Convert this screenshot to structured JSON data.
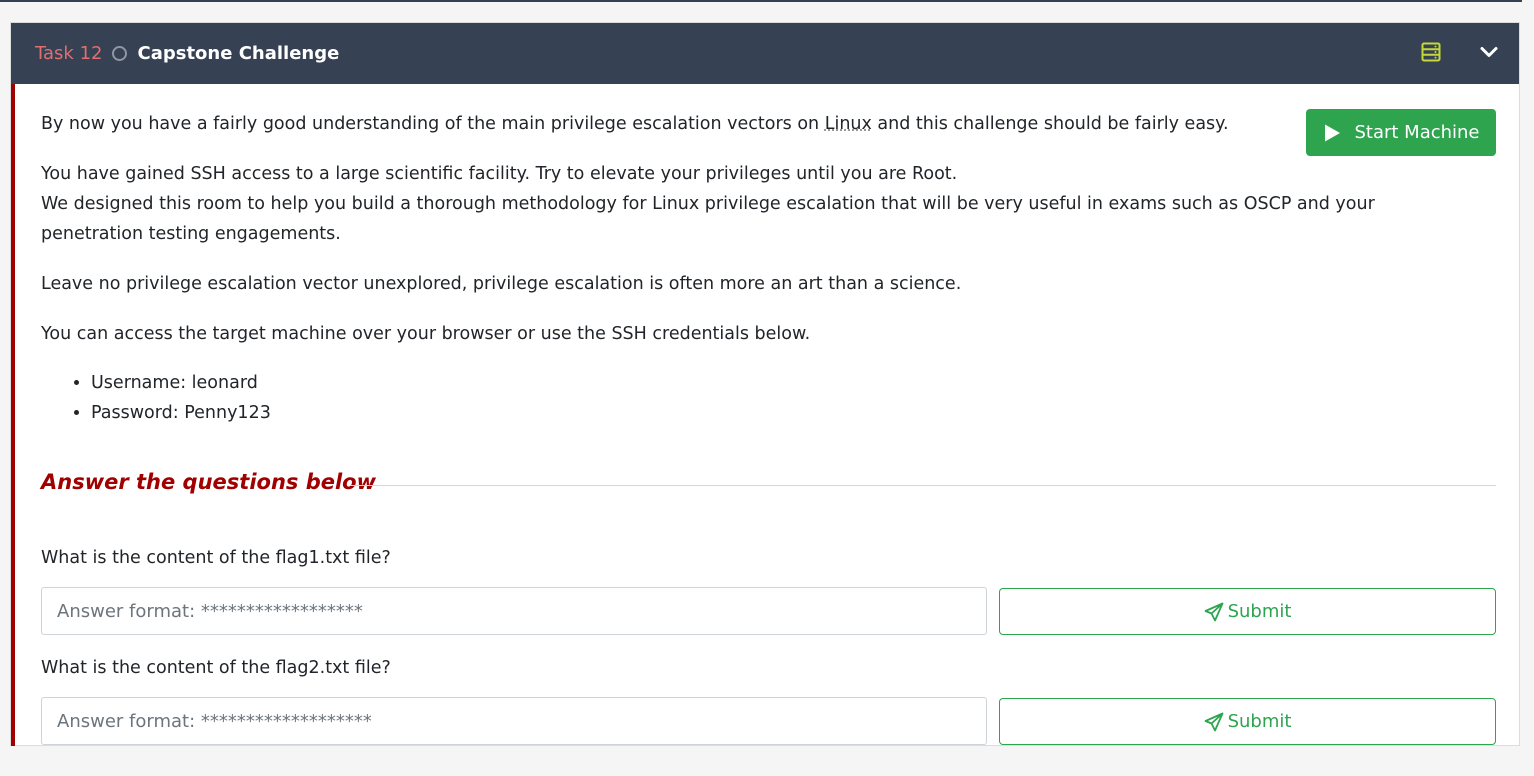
{
  "task": {
    "label": "Task 12",
    "title": "Capstone Challenge",
    "status": "incomplete"
  },
  "icons": {
    "server": "server-icon",
    "chevron": "chevron-down-icon",
    "play": "play-icon",
    "send": "paper-plane-icon"
  },
  "colors": {
    "header_bg": "#364154",
    "task_label": "#e06f6f",
    "accent_red": "#a10000",
    "green": "#2ea44f",
    "server_icon": "#c5d936"
  },
  "body": {
    "intro_before": "By now you have a fairly good understanding of the main privilege escalation vectors on ",
    "intro_abbr": "Linux",
    "intro_after": " and this challenge should be fairly easy.",
    "p2_line1": "You have gained SSH access to a large scientific facility. Try to elevate your privileges until you are Root.",
    "p2_line2": "We designed this room to help you build a thorough methodology for Linux privilege escalation that will be very useful in exams such as OSCP and your",
    "p2_line3": "penetration testing engagements.",
    "p3": "Leave no privilege escalation vector unexplored, privilege escalation is often more an art than a science.",
    "p4": "You can access the target machine over your browser or use the SSH credentials below.",
    "credentials": [
      "Username: leonard",
      "Password: Penny123"
    ]
  },
  "start_button": {
    "label": "Start Machine"
  },
  "answers": {
    "heading": "Answer the questions below",
    "questions": [
      {
        "text": "What is the content of the flag1.txt file?",
        "placeholder": "Answer format: ******************",
        "value": "",
        "submit_label": "Submit"
      },
      {
        "text": "What is the content of the flag2.txt file?",
        "placeholder": "Answer format: *******************",
        "value": "",
        "submit_label": "Submit"
      }
    ]
  }
}
